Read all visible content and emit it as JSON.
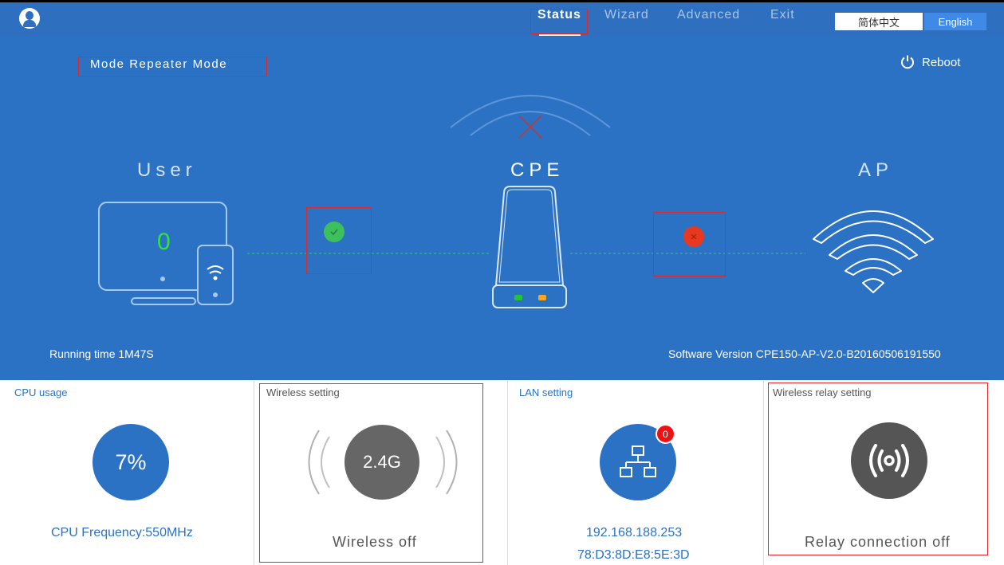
{
  "nav": {
    "items": [
      {
        "label": "Status"
      },
      {
        "label": "Wizard"
      },
      {
        "label": "Advanced"
      },
      {
        "label": "Exit"
      }
    ],
    "lang_cn": "简体中文",
    "lang_en": "English"
  },
  "banner": {
    "mode": "Mode  Repeater Mode",
    "reboot": "Reboot",
    "user_label": "User",
    "cpe_label": "CPE",
    "ap_label": "AP",
    "user_count": "0",
    "running_time": "Running time  1M47S",
    "software_version": "Software Version   CPE150-AP-V2.0-B20160506191550"
  },
  "status": {
    "user_link": "connected",
    "ap_link": "disconnected"
  },
  "panels": {
    "cpu": {
      "title": "CPU usage",
      "value": "7%",
      "frequency": "CPU Frequency:550MHz"
    },
    "wireless": {
      "title": "Wireless setting",
      "band": "2.4G",
      "status": "Wireless off"
    },
    "lan": {
      "title": "LAN setting",
      "badge": "0",
      "ip": "192.168.188.253",
      "mac": "78:D3:8D:E8:5E:3D"
    },
    "relay": {
      "title": "Wireless relay setting",
      "status": "Relay connection off"
    }
  },
  "colors": {
    "primary": "#2b72c5",
    "nav": "#2f6fbf",
    "ok": "#3cc05c",
    "error": "#e83820",
    "highlight": "#e02828"
  }
}
